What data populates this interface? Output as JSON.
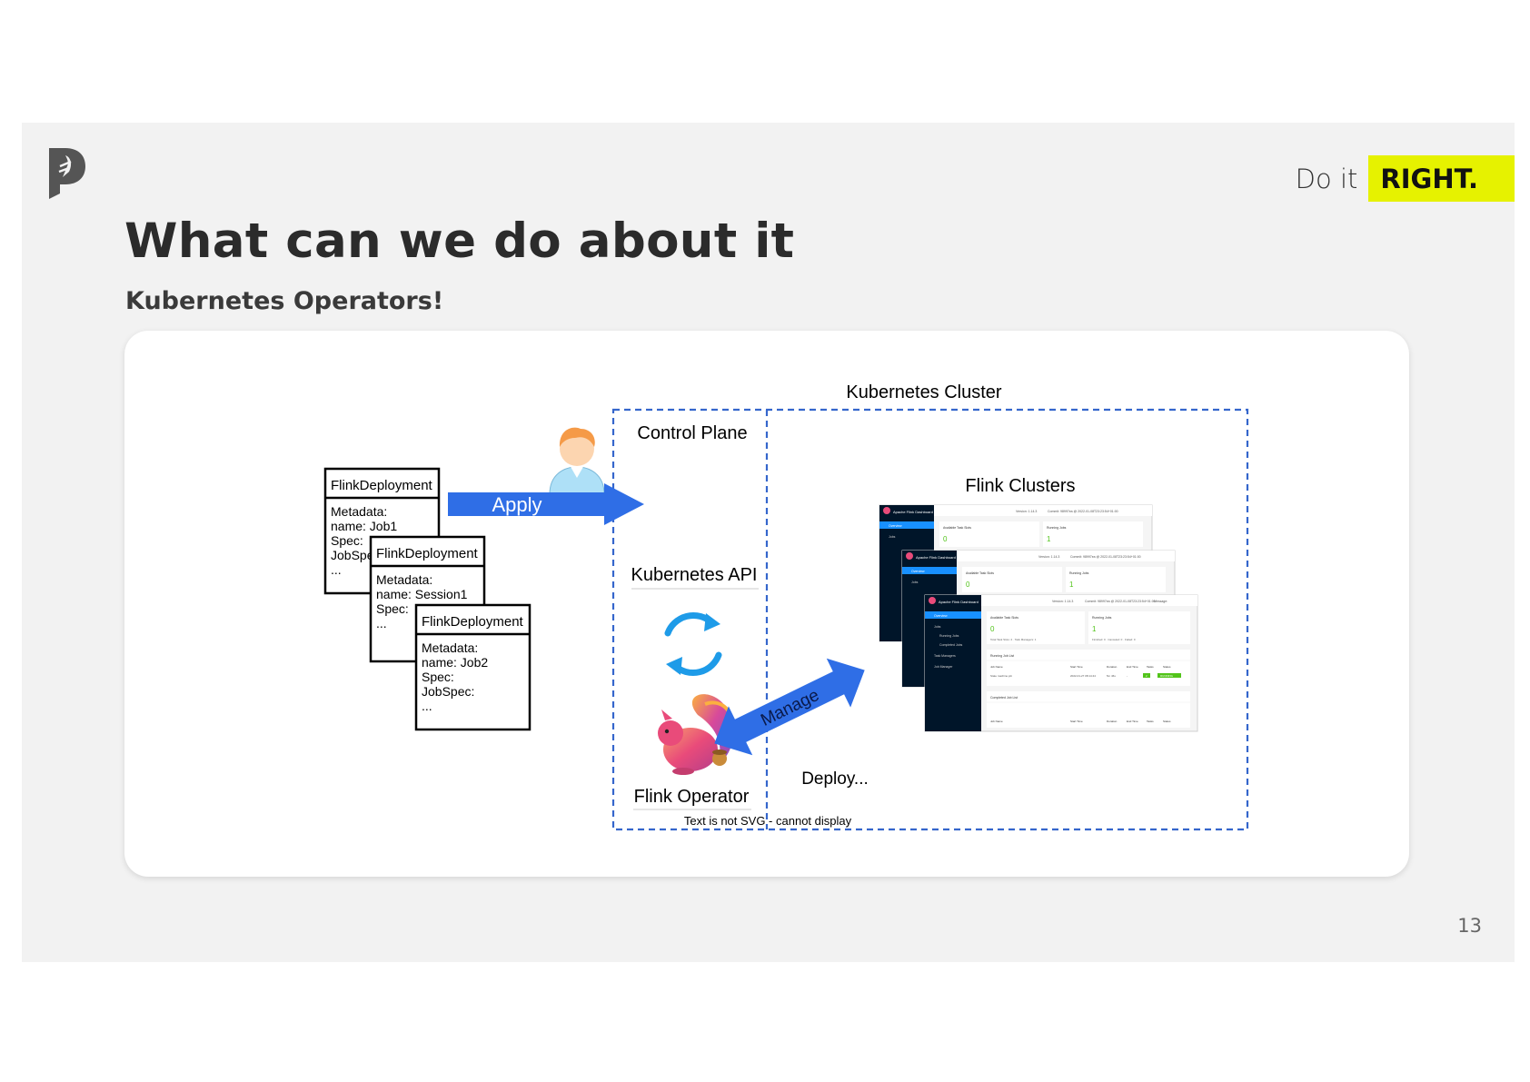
{
  "slide": {
    "tagline_do": "Do it",
    "tagline_right": "RIGHT.",
    "title": "What can we do about it",
    "subtitle": "Kubernetes Operators!",
    "page_number": "13"
  },
  "diagram": {
    "cluster_label": "Kubernetes Cluster",
    "control_plane_label": "Control Plane",
    "k8s_api_label": "Kubernetes API",
    "operator_label": "Flink Operator",
    "flink_clusters_label": "Flink Clusters",
    "apply_label": "Apply",
    "manage_label": "Manage",
    "deploy_label": "Deploy...",
    "svg_warning": "Text is not SVG - cannot display",
    "cards": [
      {
        "header": "FlinkDeployment",
        "lines": [
          "Metadata:",
          "name: Job1",
          "Spec:",
          "JobSpec:",
          "..."
        ]
      },
      {
        "header": "FlinkDeployment",
        "lines": [
          "Metadata:",
          "name: Session1",
          "Spec:",
          "..."
        ]
      },
      {
        "header": "FlinkDeployment",
        "lines": [
          "Metadata:",
          "name: Job2",
          "Spec:",
          "JobSpec:",
          "..."
        ]
      }
    ]
  },
  "dashboard": {
    "app_name": "Apache Flink Dashboard",
    "nav": [
      "Overview",
      "Jobs",
      "Running Jobs",
      "Completed Jobs",
      "Task Managers",
      "Job Manager"
    ],
    "header_version": "Version: 1.14.3",
    "header_commit": "Commit: 98997ea @ 2022-01-08T23:23:54+01:00",
    "header_message": "Message:",
    "slots_label": "Available Task Slots",
    "slots_value": "0",
    "running_label": "Running Jobs",
    "running_value": "1",
    "totals_left": "Total Task Slots: 2 · Task Managers: 1",
    "totals_right": "Finished: 0 · Canceled: 0 · Failed: 0",
    "running_list_title": "Running Job List",
    "columns": [
      "Job Name",
      "Start Time",
      "Duration",
      "End Time",
      "Tasks",
      "Status"
    ],
    "row": [
      "State machine job",
      "2022-01-27 08:14:44",
      "5m 46s",
      "-",
      "2",
      "RUNNING"
    ],
    "completed_list_title": "Completed Job List",
    "colors": {
      "nav_bg": "#001529",
      "nav_active": "#1890ff",
      "green": "#52c41a",
      "running_badge": "#52c41a"
    }
  },
  "colors": {
    "accent": "#e6f200",
    "arrow_blue": "#2f6ee6",
    "dash_blue": "#3566cc",
    "logo_gray": "#555555"
  }
}
